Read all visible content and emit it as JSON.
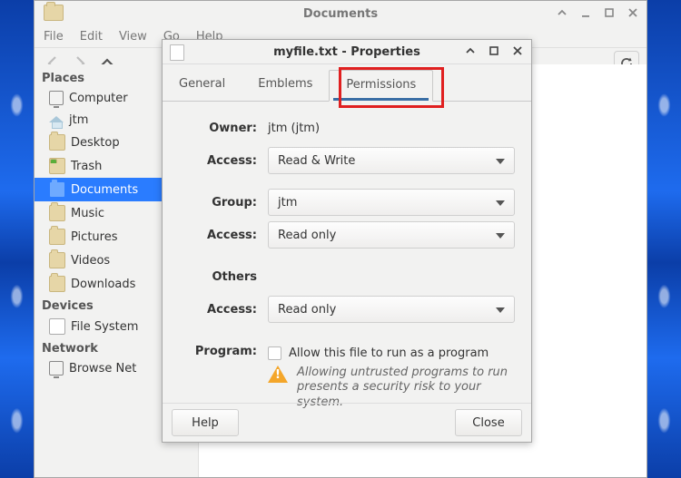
{
  "fm": {
    "title": "Documents",
    "menu": {
      "file": "File",
      "edit": "Edit",
      "view": "View",
      "go": "Go",
      "help": "Help"
    }
  },
  "sidebar": {
    "sections": {
      "places": "Places",
      "devices": "Devices",
      "network": "Network"
    },
    "places": [
      {
        "icon": "monitor",
        "label": "Computer"
      },
      {
        "icon": "home",
        "label": "jtm"
      },
      {
        "icon": "folder",
        "label": "Desktop"
      },
      {
        "icon": "trash",
        "label": "Trash"
      },
      {
        "icon": "folder-sel",
        "label": "Documents",
        "selected": true
      },
      {
        "icon": "folder",
        "label": "Music"
      },
      {
        "icon": "folder",
        "label": "Pictures"
      },
      {
        "icon": "folder",
        "label": "Videos"
      },
      {
        "icon": "folder",
        "label": "Downloads"
      }
    ],
    "devices": [
      {
        "icon": "disk",
        "label": "File System"
      }
    ],
    "network": [
      {
        "icon": "monitor",
        "label": "Browse Net"
      }
    ]
  },
  "prop": {
    "title": "myfile.txt - Properties",
    "tabs": {
      "general": "General",
      "emblems": "Emblems",
      "permissions": "Permissions"
    },
    "labels": {
      "owner": "Owner:",
      "access": "Access:",
      "group": "Group:",
      "others": "Others",
      "program": "Program:"
    },
    "owner_value": "jtm (jtm)",
    "owner_access_value": "Read & Write",
    "group_value": "jtm",
    "group_access_value": "Read only",
    "others_access_value": "Read only",
    "program_cb_label": "Allow this file to run as a program",
    "warning": "Allowing untrusted programs to run presents a security risk to your system.",
    "buttons": {
      "help": "Help",
      "close": "Close"
    }
  }
}
